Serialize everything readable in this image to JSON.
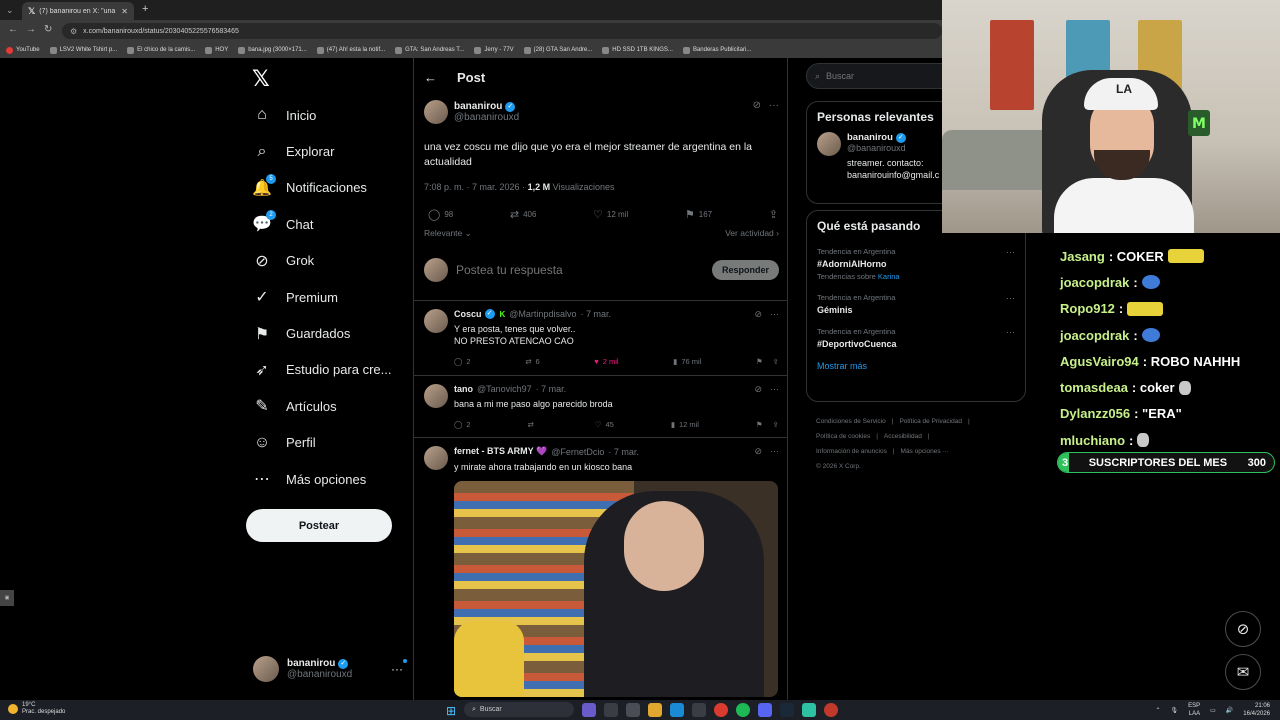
{
  "browser": {
    "tab_title": "(7) bananirou en X: \"una vez co...",
    "url": "x.com/bananirouxd/status/2030405225576583465",
    "bookmarks": [
      "YouTube",
      "LSV2 White Tshirt p...",
      "El chico de la camis...",
      "HOY",
      "bana.jpg (3000×171...",
      "(47) Ah! esta la notif...",
      "GTA: San Andreas T...",
      "Jerry - 77V",
      "(28) GTA San Andre...",
      "HD SSD 1TB KINGS...",
      "Banderas Publicitari..."
    ]
  },
  "nav": {
    "items": [
      {
        "label": "Inicio",
        "icon": "home-icon",
        "glyph": "⌂"
      },
      {
        "label": "Explorar",
        "icon": "search-icon",
        "glyph": "⌕"
      },
      {
        "label": "Notificaciones",
        "icon": "bell-icon",
        "glyph": "🔔",
        "badge": "5"
      },
      {
        "label": "Chat",
        "icon": "chat-icon",
        "glyph": "💬",
        "badge": "2"
      },
      {
        "label": "Grok",
        "icon": "grok-icon",
        "glyph": "⊘"
      },
      {
        "label": "Premium",
        "icon": "verified-icon",
        "glyph": "✓"
      },
      {
        "label": "Guardados",
        "icon": "bookmark-icon",
        "glyph": "⚑"
      },
      {
        "label": "Estudio para cre...",
        "icon": "rocket-icon",
        "glyph": "➶"
      },
      {
        "label": "Artículos",
        "icon": "article-icon",
        "glyph": "✎"
      },
      {
        "label": "Perfil",
        "icon": "profile-icon",
        "glyph": "☺"
      },
      {
        "label": "Más opciones",
        "icon": "more-circle-icon",
        "glyph": "⋯"
      }
    ],
    "post_button": "Postear",
    "account": {
      "name": "bananirou",
      "handle": "@bananirouxd"
    }
  },
  "main": {
    "title": "Post",
    "post": {
      "name": "bananirou",
      "handle": "@bananirouxd",
      "text": "una vez coscu me dijo que yo era el mejor streamer de argentina en la actualidad",
      "time": "7:08 p. m. · 7 mar. 2026 ·",
      "views": "1,2 M",
      "views_label": "Visualizaciones",
      "replies": "98",
      "reposts": "406",
      "likes": "12 mil",
      "bookmarks": "167"
    },
    "sort_label": "Relevante",
    "activity_label": "Ver actividad",
    "reply_placeholder": "Postea tu respuesta",
    "reply_button": "Responder",
    "replies": [
      {
        "name": "Coscu",
        "handle": "@Martinpdisalvo",
        "date": "· 7 mar.",
        "text": "Y era posta, tenes que volver..\nNO PRESTO ATENCAO CAO",
        "replies": "2",
        "reposts": "6",
        "likes": "2 mil",
        "views": "76 mil",
        "liked": true
      },
      {
        "name": "tano",
        "handle": "@Tanovich97",
        "date": "· 7 mar.",
        "text": "bana a mi me paso algo parecido broda",
        "replies": "2",
        "reposts": "",
        "likes": "45",
        "views": "12 mil",
        "liked": false
      },
      {
        "name": "fernet - BTS ARMY 💜",
        "handle": "@FernetDcio",
        "date": "· 7 mar.",
        "text": "y mirate ahora trabajando en un kiosco bana",
        "replies": "",
        "reposts": "",
        "likes": "",
        "views": "",
        "liked": false
      }
    ]
  },
  "right": {
    "search_placeholder": "Buscar",
    "relevant_title": "Personas relevantes",
    "relevant_user": {
      "name": "bananirou",
      "handle": "@bananirouxd",
      "bio": "streamer. contacto:\nbananirouinfo@gmail.c"
    },
    "trends_title": "Qué está pasando",
    "trends": [
      {
        "context": "Tendencia en Argentina",
        "name": "#AdorniAlHorno",
        "sub": "Tendencias sobre",
        "sub_link": "Karina"
      },
      {
        "context": "Tendencia en Argentina",
        "name": "Géminis",
        "sub": "",
        "sub_link": ""
      },
      {
        "context": "Tendencia en Argentina",
        "name": "#DeportivoCuenca",
        "sub": "",
        "sub_link": ""
      }
    ],
    "show_more": "Mostrar más",
    "footer": [
      "Condiciones de Servicio",
      "|",
      "Política de Privacidad",
      "|",
      "Política de cookies",
      "|",
      "Accesibilidad",
      "|",
      "Información de anuncios",
      "|",
      "Más opciones ···",
      "© 2026 X Corp."
    ]
  },
  "chat": {
    "lines": [
      {
        "user": "Jasang",
        "msg": ": COKER",
        "emote": "car"
      },
      {
        "user": "joacopdrak",
        "msg": ":",
        "emote": "globe"
      },
      {
        "user": "Ropo912",
        "msg": ":",
        "emote": "car"
      },
      {
        "user": "joacopdrak",
        "msg": ":",
        "emote": "globe"
      },
      {
        "user": "AgusVairo94",
        "msg": ": ROBO NAHHH",
        "emote": ""
      },
      {
        "user": "tomasdeaa",
        "msg": ": coker",
        "emote": "skull"
      },
      {
        "user": "Dylanzz056",
        "msg": ": \"ERA\"",
        "emote": ""
      },
      {
        "user": "mluchiano",
        "msg": ":",
        "emote": "skull"
      }
    ],
    "sub_goal": {
      "current": "3",
      "label": "SUSCRIPTORES DEL MES",
      "target": "300",
      "progress": 0.01
    }
  },
  "cam": {
    "cap_text": "LA"
  },
  "taskbar": {
    "weather_temp": "19°C",
    "weather_desc": "Prac. despejado",
    "search": "Buscar",
    "lang": "ESP",
    "lang2": "LAA",
    "time": "21:06",
    "date": "16/4/2026"
  }
}
